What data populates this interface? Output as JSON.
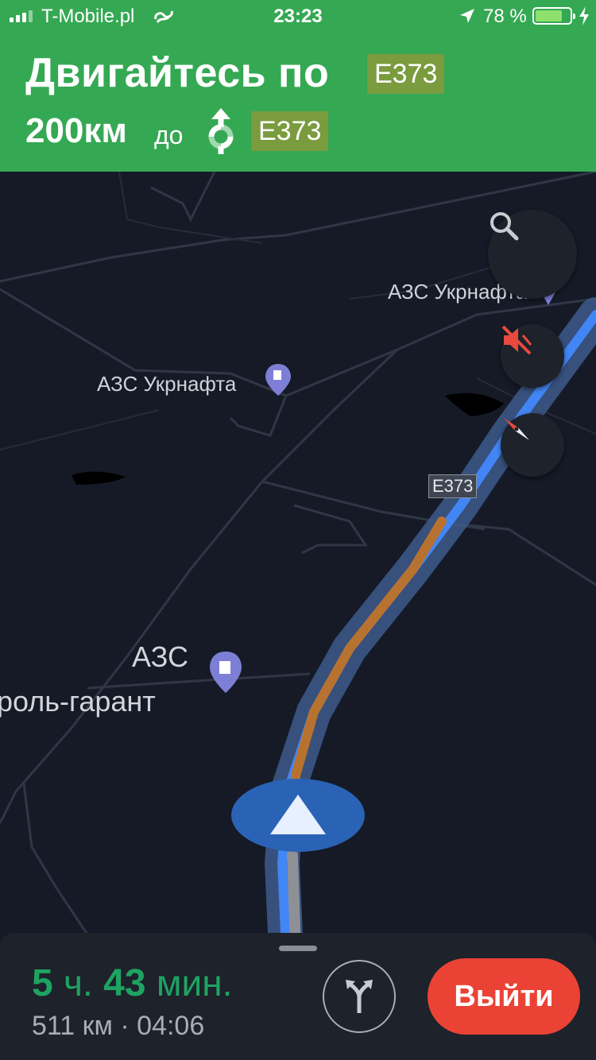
{
  "status_bar": {
    "carrier": "T-Mobile.pl",
    "time": "23:23",
    "battery": "78 %",
    "battery_level": 0.78
  },
  "navigation": {
    "instruction": "Двигайтесь по",
    "road": "E373",
    "distance": "200км",
    "to_label": "до",
    "next_road": "E373",
    "maneuver_icon": "roundabout-straight-icon"
  },
  "map": {
    "poi_labels": [
      "АЗС Укрнафта",
      "АЗС Укрнафта",
      "АЗС",
      "роль-гарант"
    ],
    "route_shield": "E373",
    "route_color": "#4285f4",
    "traffic_color": "#b8722f"
  },
  "controls": {
    "search": "search-icon",
    "mute": "volume-off-icon",
    "compass": "compass-icon"
  },
  "trip": {
    "hours": "5",
    "hours_unit": "ч.",
    "minutes": "43",
    "minutes_unit": "мин.",
    "distance": "511 км",
    "separator": "·",
    "arrival": "04:06",
    "alternatives_icon": "alt-routes-icon",
    "exit_label": "Выйти"
  }
}
